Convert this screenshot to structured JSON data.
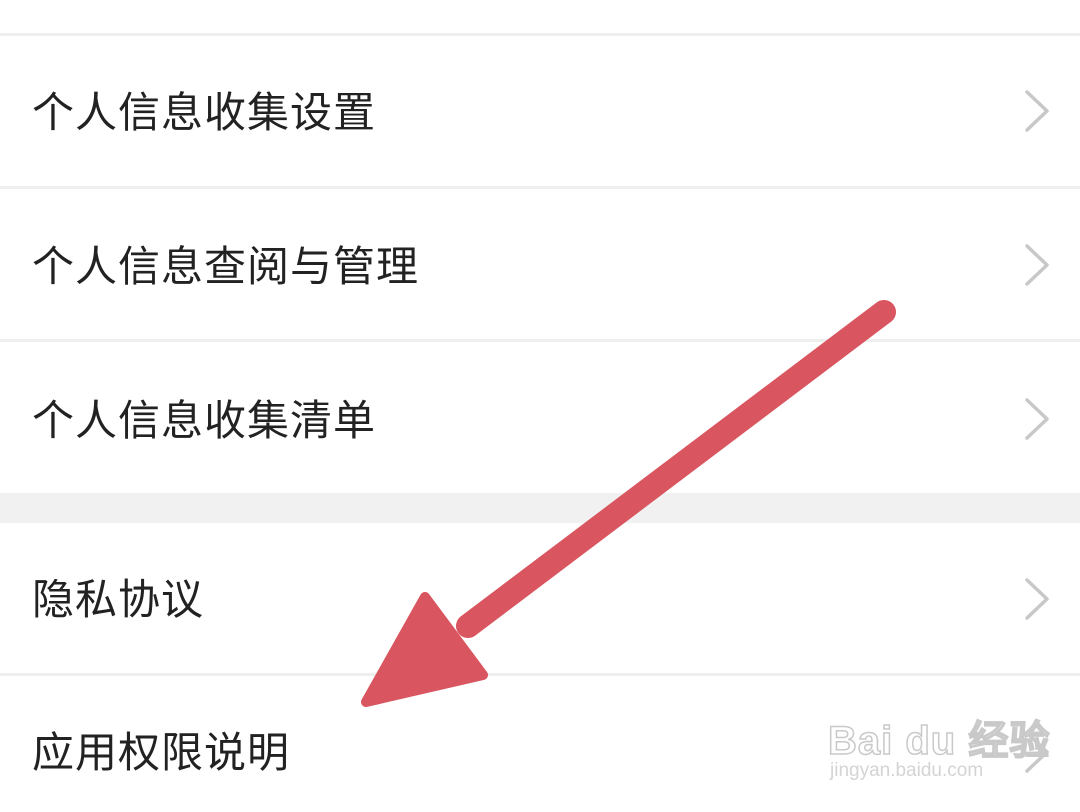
{
  "settings": {
    "items": [
      {
        "label": "个人信息收集设置",
        "icon": "chevron-right-icon"
      },
      {
        "label": "个人信息查阅与管理",
        "icon": "chevron-right-icon"
      },
      {
        "label": "个人信息收集清单",
        "icon": "chevron-right-icon"
      },
      {
        "label": "隐私协议",
        "icon": "chevron-right-icon"
      },
      {
        "label": "应用权限说明",
        "icon": "chevron-right-icon"
      }
    ]
  },
  "annotation": {
    "arrow_color": "#d9555f",
    "points_to": "应用权限说明"
  },
  "watermark": {
    "logo_text": "Bai du 经验",
    "url": "jingyan.baidu.com"
  },
  "colors": {
    "text": "#222222",
    "chevron": "#c8c8c8",
    "divider": "#efefef",
    "section_gap": "#f1f1f1"
  }
}
